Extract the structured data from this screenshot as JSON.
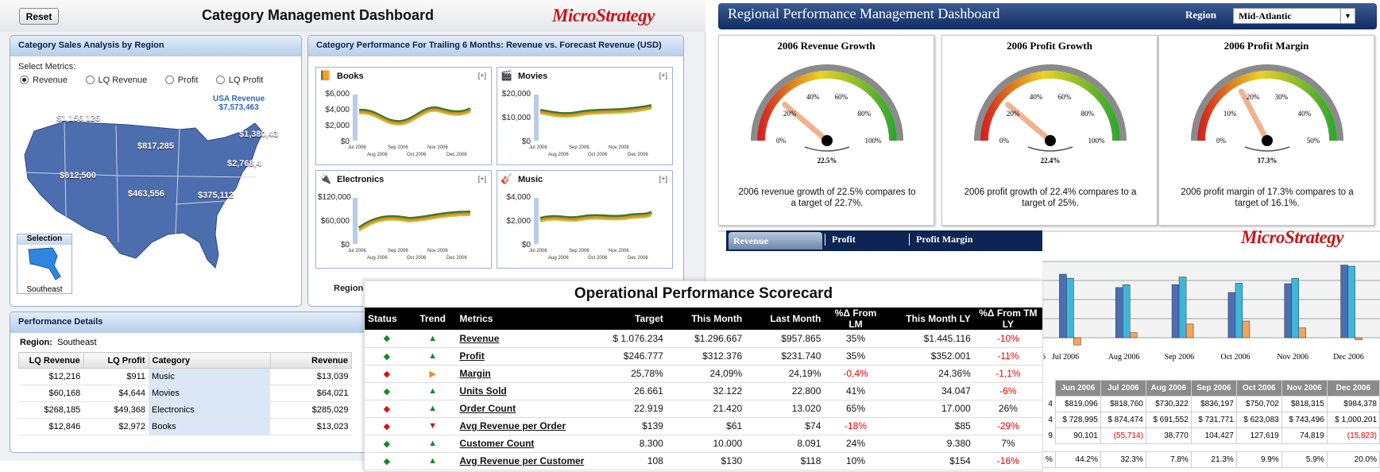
{
  "category_dashboard": {
    "reset_label": "Reset",
    "title": "Category Management Dashboard",
    "logo_text": "MicroStrategy",
    "sales_panel": {
      "title": "Category Sales Analysis by Region",
      "select_metrics_label": "Select Metrics:",
      "metrics": [
        "Revenue",
        "LQ Revenue",
        "Profit",
        "LQ Profit"
      ],
      "selected_metric": "Revenue",
      "usa_label": "USA Revenue",
      "usa_value": "$7,573,463",
      "regions": [
        "$1,156,126",
        "$817,285",
        "$1,380,43",
        "$2,768,4",
        "$612,500",
        "$463,556",
        "$375,112"
      ],
      "selection_label": "Selection",
      "selection_value": "Southeast"
    },
    "trailing_panel": {
      "title": "Category Performance For Trailing 6 Months: Revenue vs. Forecast Revenue (USD)",
      "expand_label": "[+]",
      "region_label": "Region:",
      "months_top": [
        "Jul 2006",
        "Sep 2006",
        "Nov 2006"
      ],
      "months_bottom": [
        "Aug 2006",
        "Oct 2006",
        "Dec 2006"
      ],
      "charts": [
        {
          "title": "Books",
          "ticks": [
            "$6,000",
            "$4,000",
            "$2,000",
            "$0"
          ]
        },
        {
          "title": "Movies",
          "ticks": [
            "$20,000",
            "$10,000",
            "$0"
          ]
        },
        {
          "title": "Electronics",
          "ticks": [
            "$120,000",
            "$60,000",
            "$0"
          ]
        },
        {
          "title": "Music",
          "ticks": [
            "$4,000",
            "$2,000",
            "$0"
          ]
        }
      ]
    },
    "details_panel": {
      "title": "Performance Details",
      "region_label": "Region:",
      "region_value": "Southeast",
      "columns": [
        "LQ Revenue",
        "LQ Profit",
        "Category",
        "Revenue"
      ],
      "rows": [
        [
          "$12,216",
          "$911",
          "Music",
          "$13,039"
        ],
        [
          "$60,168",
          "$4,644",
          "Movies",
          "$64,021"
        ],
        [
          "$268,185",
          "$49,368",
          "Electronics",
          "$285,029"
        ],
        [
          "$12,846",
          "$2,972",
          "Books",
          "$13,023"
        ]
      ]
    }
  },
  "regional_dashboard": {
    "title": "Regional Performance Management Dashboard",
    "region_label": "Region",
    "region_value": "Mid-Atlantic",
    "gauges": [
      {
        "title": "2006 Revenue Growth",
        "value": 22.5,
        "value_label": "22.5%",
        "max": 100,
        "ticks": [
          "0%",
          "20%",
          "40%",
          "60%",
          "80%",
          "100%"
        ],
        "description": "2006 revenue growth of 22.5% compares to a target of 22.7%."
      },
      {
        "title": "2006 Profit Growth",
        "value": 22.4,
        "value_label": "22.4%",
        "max": 100,
        "ticks": [
          "0%",
          "20%",
          "40%",
          "60%",
          "80%",
          "100%"
        ],
        "description": "2006 profit growth of 22.4% compares to a target of 25%."
      },
      {
        "title": "2006 Profit Margin",
        "value": 17.3,
        "value_label": "17.3%",
        "max": 50,
        "ticks": [
          "0%",
          "10%",
          "20%",
          "30%",
          "40%",
          "50%"
        ],
        "description": "2006 profit margin of 17.3% compares to a target of 16.1%."
      }
    ],
    "tabs": [
      "Revenue",
      "Profit",
      "Profit Margin"
    ],
    "active_tab": "Revenue",
    "logo_text": "MicroStrategy",
    "axis_fragment": "06",
    "bar_months": [
      "Jul 2006",
      "Aug 2006",
      "Sep 2006",
      "Oct 2006",
      "Nov 2006",
      "Dec 2006"
    ],
    "table_months": [
      "Jun 2006",
      "Jul 2006",
      "Aug 2006",
      "Sep 2006",
      "Oct 2006",
      "Nov 2006",
      "Dec 2006"
    ],
    "table_rows": [
      [
        "4",
        "$819,096",
        "$818,760",
        "$730,322",
        "$836,197",
        "$750,702",
        "$818,315",
        "$984,378"
      ],
      [
        "4",
        "$ 728,995",
        "$ 874,474",
        "$ 691,552",
        "$ 731,771",
        "$ 623,083",
        "$ 743,496",
        "$ 1,000,201"
      ],
      [
        "9",
        "90,101",
        "(55,714)",
        "38,770",
        "104,427",
        "127,619",
        "74,819",
        "(15,823)"
      ]
    ],
    "pct_row": [
      "%",
      "44.2%",
      "32.3%",
      "7.8%",
      "21.3%",
      "9.9%",
      "5.9%",
      "20.0%"
    ]
  },
  "chart_data": [
    {
      "type": "bar",
      "title": "",
      "categories": [
        "Jul 2006",
        "Aug 2006",
        "Sep 2006",
        "Oct 2006",
        "Nov 2006",
        "Dec 2006"
      ],
      "series": [
        {
          "values": [
            874474,
            691552,
            731771,
            623083,
            743496,
            1000201
          ]
        },
        {
          "values": [
            818760,
            730322,
            836197,
            750702,
            818315,
            984378
          ]
        },
        {
          "values": [
            -55714,
            38770,
            104427,
            127619,
            74819,
            -15823
          ]
        }
      ],
      "colors": [
        "#4b6fb5",
        "#3fb6d9",
        "#f2a45b"
      ],
      "grid": true
    }
  ],
  "scorecard": {
    "title": "Operational Performance Scorecard",
    "columns": [
      "Status",
      "Trend",
      "Metrics",
      "Target",
      "This Month",
      "Last Month",
      "%Δ From LM",
      "This Month LY",
      "%Δ From TM LY"
    ],
    "rows": [
      {
        "status": "green",
        "trend": "up",
        "metric": "Revenue",
        "target": "$ 1.076.234",
        "this_month": "$1.296.667",
        "last_month": "$957.865",
        "from_lm": "35%",
        "lm_neg": false,
        "ly": "$1.445.116",
        "from_ly": "-10%",
        "ly_neg": true
      },
      {
        "status": "green",
        "trend": "up",
        "metric": "Profit",
        "target": "$246.777",
        "this_month": "$312.376",
        "last_month": "$231.740",
        "from_lm": "35%",
        "lm_neg": false,
        "ly": "$352.001",
        "from_ly": "-11%",
        "ly_neg": true
      },
      {
        "status": "red",
        "trend": "flat",
        "metric": "Margin",
        "target": "25,78%",
        "this_month": "24,09%",
        "last_month": "24,19%",
        "from_lm": "-0,4%",
        "lm_neg": true,
        "ly": "24,36%",
        "from_ly": "-1,1%",
        "ly_neg": true
      },
      {
        "status": "green",
        "trend": "up",
        "metric": "Units Sold",
        "target": "26.661",
        "this_month": "32.122",
        "last_month": "22.800",
        "from_lm": "41%",
        "lm_neg": false,
        "ly": "34.047",
        "from_ly": "-6%",
        "ly_neg": true
      },
      {
        "status": "red",
        "trend": "up",
        "metric": "Order Count",
        "target": "22.919",
        "this_month": "21.420",
        "last_month": "13.020",
        "from_lm": "65%",
        "lm_neg": false,
        "ly": "17.000",
        "from_ly": "26%",
        "ly_neg": false
      },
      {
        "status": "red",
        "trend": "down",
        "metric": "Avg Revenue per Order",
        "target": "$139",
        "this_month": "$61",
        "last_month": "$74",
        "from_lm": "-18%",
        "lm_neg": true,
        "ly": "$85",
        "from_ly": "-29%",
        "ly_neg": true
      },
      {
        "status": "green",
        "trend": "up",
        "metric": "Customer Count",
        "target": "8.300",
        "this_month": "10.000",
        "last_month": "8.091",
        "from_lm": "24%",
        "lm_neg": false,
        "ly": "9.380",
        "from_ly": "7%",
        "ly_neg": false
      },
      {
        "status": "green",
        "trend": "up",
        "metric": "Avg Revenue per Customer",
        "target": "108",
        "this_month": "$130",
        "last_month": "$118",
        "from_lm": "10%",
        "lm_neg": false,
        "ly": "$154",
        "from_ly": "-16%",
        "ly_neg": true
      }
    ]
  }
}
